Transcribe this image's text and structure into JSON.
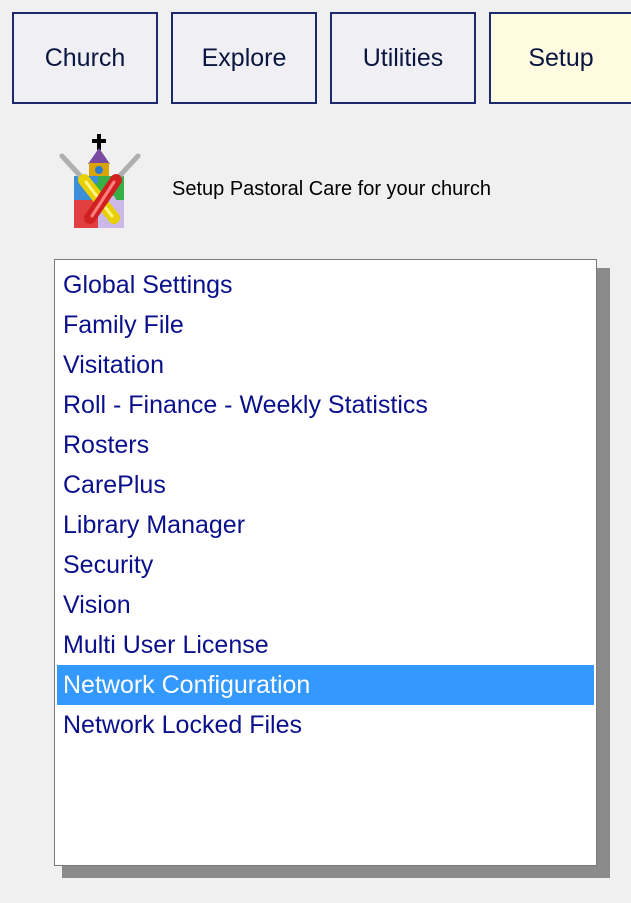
{
  "tabs": [
    {
      "label": "Church",
      "active": false
    },
    {
      "label": "Explore",
      "active": false
    },
    {
      "label": "Utilities",
      "active": false
    },
    {
      "label": "Setup",
      "active": true
    }
  ],
  "header": {
    "icon": "setup-tools-icon",
    "text": "Setup Pastoral Care for your church"
  },
  "setup_list": {
    "items": [
      "Global Settings",
      "Family File",
      "Visitation",
      "Roll - Finance - Weekly Statistics",
      "Rosters",
      "CarePlus",
      "Library Manager",
      "Security",
      "Vision",
      "Multi User License",
      "Network Configuration",
      "Network Locked Files"
    ],
    "selected": "Network Configuration"
  },
  "colors": {
    "selection": "#3399ff",
    "item_text": "#0a0f8c",
    "active_tab": "#fffbe0",
    "tab_border": "#1c2a6b"
  }
}
